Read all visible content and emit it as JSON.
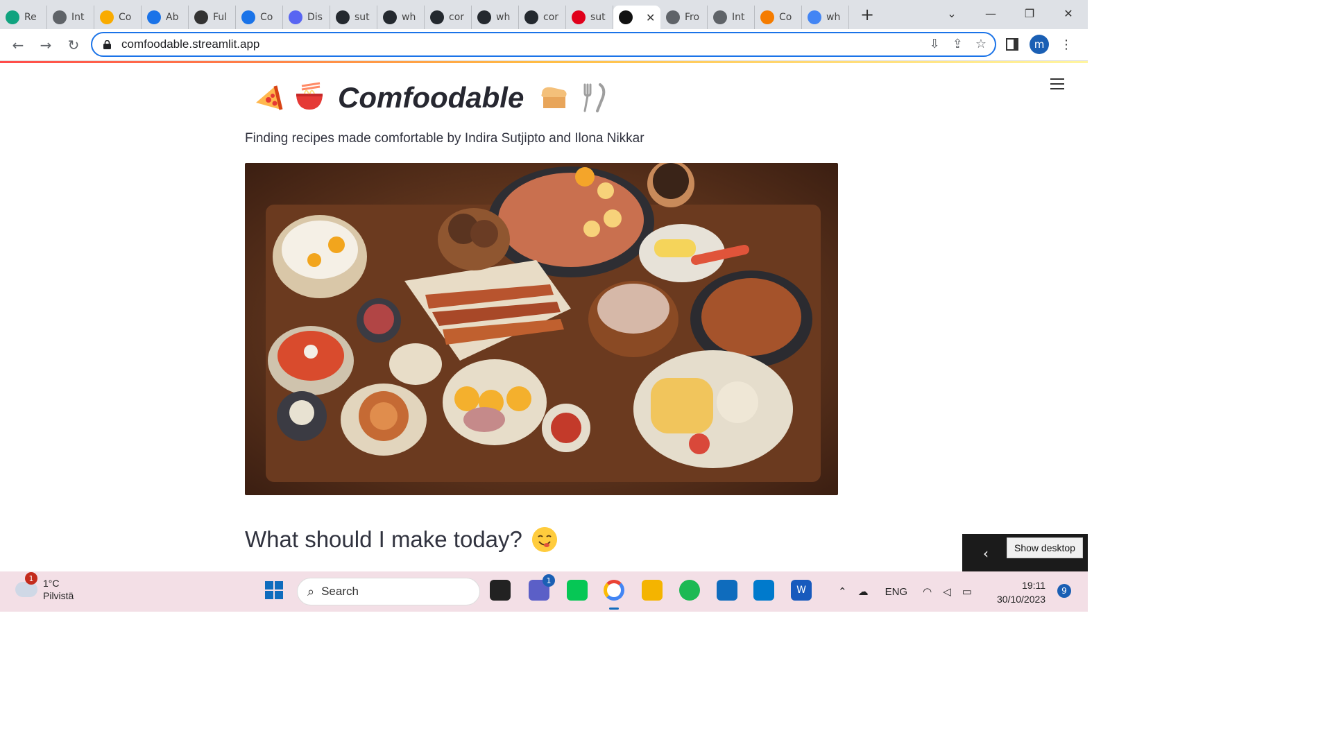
{
  "browser": {
    "tabs": [
      {
        "label": "Re",
        "icon": "chatgpt-icon",
        "color": "#10a37f"
      },
      {
        "label": "Int",
        "icon": "globe-icon",
        "color": "#5f6368"
      },
      {
        "label": "Co",
        "icon": "colab-icon",
        "color": "#f9ab00"
      },
      {
        "label": "Ab",
        "icon": "shield-icon",
        "color": "#1a73e8"
      },
      {
        "label": "Ful",
        "icon": "square-icon",
        "color": "#333333"
      },
      {
        "label": "Co",
        "icon": "shield-icon",
        "color": "#1a73e8"
      },
      {
        "label": "Dis",
        "icon": "discord-icon",
        "color": "#5865f2"
      },
      {
        "label": "sut",
        "icon": "github-icon",
        "color": "#24292f"
      },
      {
        "label": "wh",
        "icon": "github-icon",
        "color": "#24292f"
      },
      {
        "label": "cor",
        "icon": "github-icon",
        "color": "#24292f"
      },
      {
        "label": "wh",
        "icon": "github-icon",
        "color": "#24292f"
      },
      {
        "label": "cor",
        "icon": "github-icon",
        "color": "#24292f"
      },
      {
        "label": "sut",
        "icon": "streamlit-icon",
        "color": "#e0001b"
      },
      {
        "label": "",
        "icon": "streamlit-crown-icon",
        "color": "#111111",
        "active": true
      },
      {
        "label": "Fro",
        "icon": "globe-icon",
        "color": "#5f6368"
      },
      {
        "label": "Int",
        "icon": "globe-icon",
        "color": "#5f6368"
      },
      {
        "label": "Co",
        "icon": "coursera-icon",
        "color": "#f57c00"
      },
      {
        "label": "wh",
        "icon": "google-icon",
        "color": "#4285f4"
      }
    ],
    "url": "comfoodable.streamlit.app",
    "profile_initial": "m"
  },
  "app": {
    "title": "Comfoodable",
    "subtitle": "Finding recipes made comfortable by Indira Sutjipto and Ilona Nikkar",
    "section_heading": "What should I make today?",
    "title_emojis": [
      "pizza-icon",
      "ramen-icon",
      "bread-icon",
      "fork-knife-icon"
    ],
    "hero_image": "food-feast-illustration"
  },
  "overlay": {
    "tooltip": "Show desktop"
  },
  "taskbar": {
    "weather": {
      "temp": "1°C",
      "desc": "Pilvistä",
      "badge": "1"
    },
    "search_placeholder": "Search",
    "teams_badge": "1",
    "tray": {
      "language": "ENG"
    },
    "clock": {
      "time": "19:11",
      "date": "30/10/2023"
    },
    "notifications": "9"
  }
}
